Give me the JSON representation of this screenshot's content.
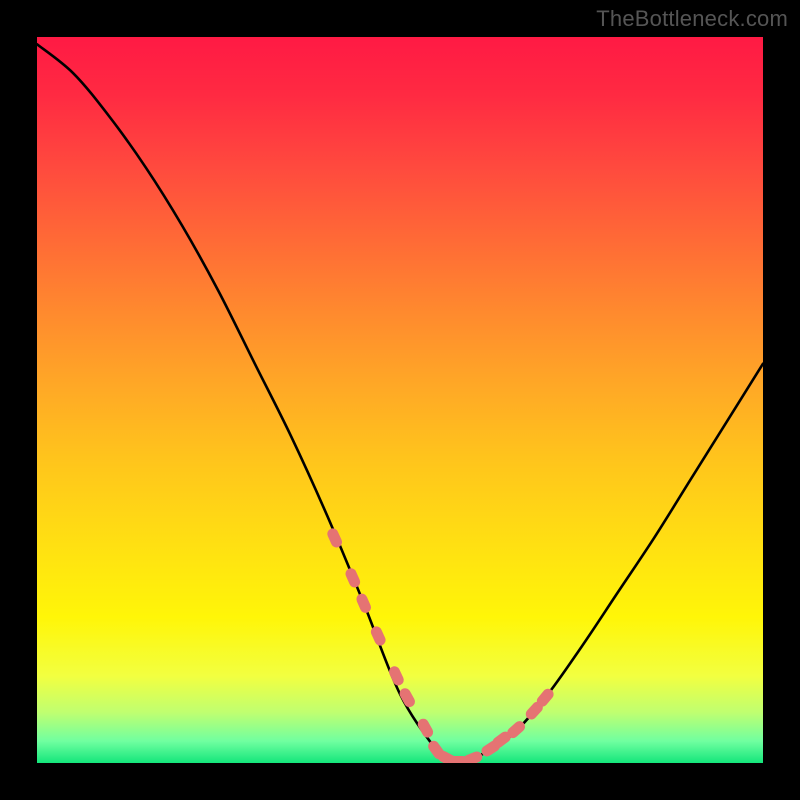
{
  "watermark": "TheBottleneck.com",
  "chart_data": {
    "type": "line",
    "title": "",
    "xlabel": "",
    "ylabel": "",
    "xlim": [
      0,
      100
    ],
    "ylim": [
      0,
      100
    ],
    "series": [
      {
        "name": "bottleneck-curve",
        "x": [
          0,
          5,
          10,
          15,
          20,
          25,
          30,
          35,
          40,
          45,
          50,
          55,
          57,
          60,
          65,
          70,
          75,
          80,
          85,
          90,
          95,
          100
        ],
        "values": [
          99,
          95,
          89,
          82,
          74,
          65,
          55,
          45,
          34,
          22,
          9.5,
          1.8,
          0,
          0.6,
          3.5,
          9,
          16,
          23.5,
          31,
          39,
          47,
          55
        ]
      }
    ],
    "markers": {
      "name": "highlight-dots",
      "x": [
        41,
        43.5,
        45,
        47,
        49.5,
        51,
        53.5,
        55,
        56.5,
        58,
        60,
        62.5,
        64,
        66,
        68.5,
        70
      ],
      "values": [
        31,
        25.5,
        22,
        17.5,
        12,
        9,
        4.8,
        1.8,
        0.6,
        0.2,
        0.6,
        2,
        3.2,
        4.6,
        7.2,
        9
      ]
    },
    "gradient_stops": [
      {
        "pos": 0.0,
        "color": "#ff1a44"
      },
      {
        "pos": 0.5,
        "color": "#ffb020"
      },
      {
        "pos": 0.8,
        "color": "#fff608"
      },
      {
        "pos": 1.0,
        "color": "#14e67b"
      }
    ]
  }
}
